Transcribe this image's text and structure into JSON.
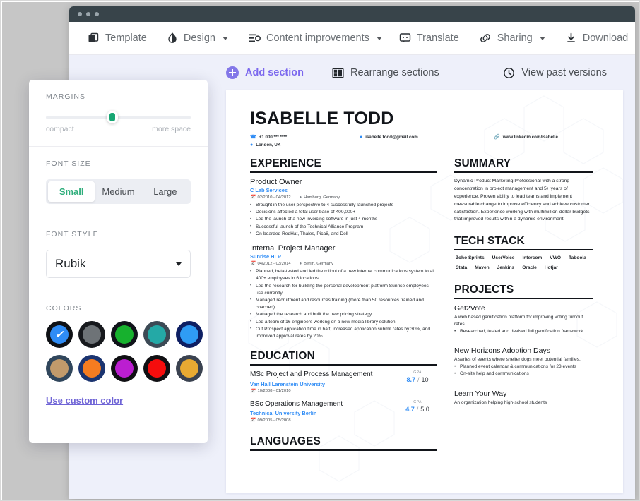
{
  "toolbar": {
    "items": [
      {
        "label": "Template",
        "icon": "template-icon",
        "caret": false
      },
      {
        "label": "Design",
        "icon": "design-contrast-icon",
        "caret": true
      },
      {
        "label": "Content improvements",
        "icon": "content-list-icon",
        "caret": true
      }
    ],
    "right_items": [
      {
        "label": "Translate",
        "icon": "translate-icon",
        "caret": false
      },
      {
        "label": "Sharing",
        "icon": "link-icon",
        "caret": true
      },
      {
        "label": "Download",
        "icon": "download-icon",
        "caret": false
      }
    ]
  },
  "subbar": {
    "add_section": "Add section",
    "rearrange": "Rearrange sections",
    "past_versions": "View past versions"
  },
  "panel": {
    "margins": {
      "label": "MARGINS",
      "left_end": "compact",
      "right_end": "more space",
      "value_percent": 46,
      "knob_color": "#17a673"
    },
    "font_size": {
      "label": "FONT SIZE",
      "options": [
        "Small",
        "Medium",
        "Large"
      ],
      "selected": "Small",
      "selected_color": "#2fae7c"
    },
    "font_style": {
      "label": "FONT STYLE",
      "selected": "Rubik"
    },
    "colors": {
      "label": "COLORS",
      "custom_link": "Use custom color",
      "selected_index": 0,
      "swatches": [
        {
          "ring": "#0f1115",
          "fill": "#2f8cf5",
          "selected": true
        },
        {
          "ring": "#17191d",
          "fill": "#6e7377",
          "selected": false
        },
        {
          "ring": "#10131a",
          "fill": "#17b12e",
          "selected": false
        },
        {
          "ring": "#3c4a55",
          "fill": "#24a9a6",
          "selected": false
        },
        {
          "ring": "#0e1f63",
          "fill": "#2f9cf5",
          "selected": false
        },
        {
          "ring": "#30465c",
          "fill": "#c19a6b",
          "selected": false
        },
        {
          "ring": "#1b3470",
          "fill": "#f57c20",
          "selected": false
        },
        {
          "ring": "#101013",
          "fill": "#bb1ed0",
          "selected": false
        },
        {
          "ring": "#101013",
          "fill": "#f50d0d",
          "selected": false
        },
        {
          "ring": "#3a4250",
          "fill": "#e8aa32",
          "selected": false
        }
      ]
    }
  },
  "resume": {
    "name": "ISABELLE TODD",
    "contacts": [
      {
        "icon": "phone-icon",
        "text": "+1 000 *** ****"
      },
      {
        "icon": "email-icon",
        "text": "isabelle.todd@gmail.com"
      },
      {
        "icon": "link-icon",
        "text": "www.linkedin.com/isabelle"
      },
      {
        "icon": "location-icon",
        "text": "London, UK"
      }
    ],
    "experience": {
      "heading": "EXPERIENCE",
      "jobs": [
        {
          "title": "Product Owner",
          "org": "C Lab Services",
          "dates": "02/2010 - 04/2012",
          "location": "Hamburg, Germany",
          "bullets": [
            "Brought in the user perspective to 4 successfully launched projects",
            "Decisions affected a total user base of 400,000+",
            "Led the launch of a new invoicing software in just 4 months",
            "Successful launch of the Technical Alliance Program",
            "On-boarded RedHat, Thales, Pica8, and Dell"
          ]
        },
        {
          "title": "Internal Project Manager",
          "org": "Sunrise HLP",
          "dates": "04/2012 - 03/2014",
          "location": "Berlin, Germany",
          "bullets": [
            "Planned, beta-tested and led the rollout of a new internal communications system to all 400+ employees in 6 locations",
            "Led the research for building the personal development platform Sunrise employees use currently",
            "Managed recruitment and resources training (more than 50 resources trained and coached)",
            "Managed the research and built the new pricing strategy",
            "Led a team of 16 engineers working on a new media library solution",
            "Cut Prospect application time in half, increased application submit rates by 30%, and improved approval rates by 20%"
          ]
        }
      ]
    },
    "education": {
      "heading": "EDUCATION",
      "entries": [
        {
          "degree": "MSc Project and Process Management",
          "org": "Van Hall Larenstein University",
          "dates": "10/2008 - 01/2010",
          "gpa_label": "GPA",
          "gpa_value": "8.7",
          "gpa_scale": "10"
        },
        {
          "degree": "BSc Operations Management",
          "org": "Technical University Berlin",
          "dates": "09/2005 - 05/2008",
          "gpa_label": "GPA",
          "gpa_value": "4.7",
          "gpa_scale": "5.0"
        }
      ]
    },
    "languages": {
      "heading": "LANGUAGES"
    },
    "summary": {
      "heading": "SUMMARY",
      "text": "Dynamic Product Marketing Professional with a strong concentration in project management and 5+ years of experience. Proven ability to lead teams and implement measurable change to improve efficiency and achieve customer satisfaction. Experience working with multimillion-dollar budgets that improved results within a dynamic environment."
    },
    "tech_stack": {
      "heading": "TECH STACK",
      "items": [
        "Zoho Sprints",
        "UserVoice",
        "Intercom",
        "VWO",
        "Taboola",
        "Stata",
        "Maven",
        "Jenkins",
        "Oracle",
        "Hotjar"
      ]
    },
    "projects": {
      "heading": "PROJECTS",
      "entries": [
        {
          "title": "Get2Vote",
          "desc": "A web based gamification platform for improving voting turnout rates.",
          "bullets": [
            "Researched, tested and devised full gamification framework"
          ]
        },
        {
          "title": "New Horizons Adoption Days",
          "desc": "A series of events where shelter dogs meet potential families.",
          "bullets": [
            "Planned event calendar & communications for 23 events",
            "On-site help and communications"
          ]
        },
        {
          "title": "Learn Your Way",
          "desc": "An organization helping high-school students",
          "bullets": []
        }
      ]
    }
  }
}
